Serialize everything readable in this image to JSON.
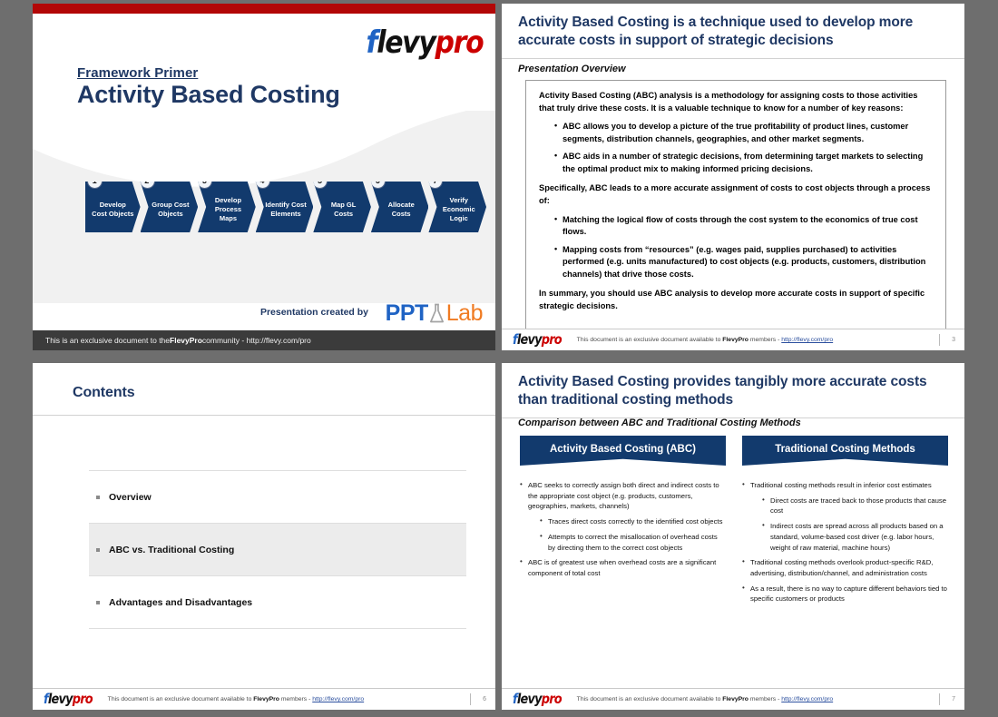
{
  "deck": {
    "brand_logo": {
      "part1": "f",
      "part2": "levy",
      "part3": "pro"
    },
    "colors": {
      "navy": "#1f3864",
      "chevron_navy": "#123a6d",
      "red": "#b20707",
      "logo_blue": "#1f63c4",
      "logo_red": "#cc0000",
      "orange": "#f07b22"
    }
  },
  "slide1": {
    "kicker": "Framework Primer",
    "title": "Activity Based Costing",
    "process_steps": [
      {
        "num": "1",
        "label": "Develop Cost Objects"
      },
      {
        "num": "2",
        "label": "Group Cost Objects"
      },
      {
        "num": "3",
        "label": "Develop Process Maps"
      },
      {
        "num": "4",
        "label": "Identify Cost Elements"
      },
      {
        "num": "5",
        "label": "Map GL Costs"
      },
      {
        "num": "6",
        "label": "Allocate Costs"
      },
      {
        "num": "7",
        "label": "Verify Economic Logic"
      }
    ],
    "created_by": "Presentation created by",
    "pptlab": {
      "ppt": "PPT",
      "lab": "Lab"
    },
    "bottom_bar": {
      "pre": "This is an exclusive document to the ",
      "brand": "FlevyPro",
      "post": " community - http://flevy.com/pro"
    }
  },
  "slide2": {
    "title": "Activity Based Costing is a technique used to develop more accurate costs in support of strategic decisions",
    "subtitle": "Presentation Overview",
    "body": {
      "para1": "Activity Based Costing (ABC) analysis is a methodology for assigning costs to those activities that truly drive these costs.  It is a valuable technique to know for a number of key reasons:",
      "bullets1": [
        "ABC allows you to develop a picture of the true profitability of product lines, customer segments, distribution channels, geographies, and other market segments.",
        "ABC aids in a number of strategic decisions, from determining target markets to selecting the optimal product mix to making informed pricing decisions."
      ],
      "para2": "Specifically, ABC leads to a more accurate assignment of costs to cost objects through a process of:",
      "bullets2": [
        "Matching the logical flow of costs through the cost system to the economics of true cost flows.",
        "Mapping costs from “resources” (e.g. wages paid, supplies purchased) to activities performed (e.g. units manufactured) to cost objects (e.g. products, customers, distribution channels) that drive those costs."
      ],
      "para3": "In summary, you should use ABC analysis to develop more accurate costs in support of specific strategic decisions."
    },
    "footer": {
      "pre": "This document is an exclusive document available to ",
      "brand": "FlevyPro",
      "mid": " members - ",
      "link": "http://flevy.com/pro"
    },
    "page": "3"
  },
  "slide3": {
    "title": "Contents",
    "items": [
      {
        "label": "Overview",
        "highlighted": false
      },
      {
        "label": "ABC vs. Traditional Costing",
        "highlighted": true
      },
      {
        "label": "Advantages and Disadvantages",
        "highlighted": false
      }
    ],
    "footer": {
      "pre": "This document is an exclusive document available to ",
      "brand": "FlevyPro",
      "mid": " members - ",
      "link": "http://flevy.com/pro"
    },
    "page": "6"
  },
  "slide4": {
    "title": "Activity Based Costing provides tangibly more accurate costs than traditional costing methods",
    "subtitle": "Comparison between ABC and Traditional Costing Methods",
    "left": {
      "banner": "Activity Based Costing (ABC)",
      "bullets": [
        {
          "text": "ABC seeks to correctly assign both direct and indirect costs to the appropriate cost object (e.g. products, customers, geographies, markets, channels)",
          "sub": [
            "Traces direct costs correctly to the identified cost objects",
            "Attempts to correct the misallocation of overhead costs by directing them to the correct cost objects"
          ]
        },
        {
          "text": "ABC is of greatest use when overhead costs are a significant component of total cost",
          "sub": []
        }
      ]
    },
    "right": {
      "banner": "Traditional Costing Methods",
      "bullets": [
        {
          "text": "Traditional costing methods result in inferior cost estimates",
          "sub": [
            "Direct costs are traced back to those products that cause cost",
            "Indirect costs are spread across all products based on a standard, volume-based cost driver (e.g. labor hours, weight of raw material, machine hours)"
          ]
        },
        {
          "text": "Traditional costing methods overlook product-specific R&D, advertising, distribution/channel, and administration costs",
          "sub": []
        },
        {
          "text": "As a result, there is no way to capture different behaviors tied to specific customers or products",
          "sub": []
        }
      ]
    },
    "footer": {
      "pre": "This document is an exclusive document available to ",
      "brand": "FlevyPro",
      "mid": " members - ",
      "link": "http://flevy.com/pro"
    },
    "page": "7"
  }
}
